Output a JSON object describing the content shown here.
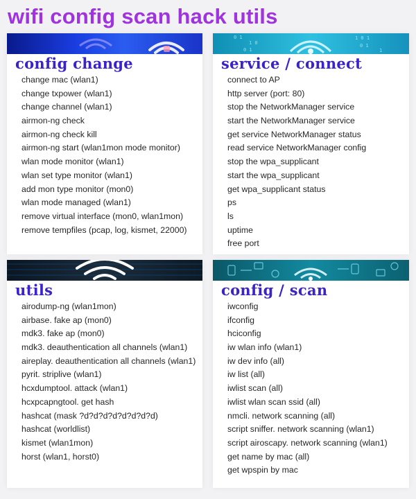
{
  "page": {
    "title": "wifi config scan hack utils"
  },
  "colors": {
    "title": "#9f34de",
    "card_heading": "#3b23c8",
    "item_text": "#262626",
    "background": "#f2f2f4"
  },
  "cards": {
    "config_change": {
      "title": "config change",
      "banner_icon": "wifi-icon",
      "items": [
        "change mac (wlan1)",
        "change txpower (wlan1)",
        "change channel (wlan1)",
        "airmon-ng check",
        "airmon-ng check kill",
        "airmon-ng start (wlan1mon mode monitor)",
        "wlan mode monitor (wlan1)",
        "wlan set type monitor (wlan1)",
        "add mon type monitor (mon0)",
        "wlan mode managed (wlan1)",
        "remove virtual interface (mon0, wlan1mon)",
        "remove tempfiles (pcap, log, kismet, 22000)"
      ]
    },
    "service_connect": {
      "title": "service / connect",
      "banner_icon": "wifi-icon",
      "items": [
        "connect to AP",
        "http server (port: 80)",
        "stop the NetworkManager service",
        "start the NetworkManager service",
        "get service NetworkManager status",
        "read service NetworkManager config",
        "stop the wpa_supplicant",
        "start the wpa_supplicant",
        "get wpa_supplicant status",
        "ps",
        "ls",
        "uptime",
        "free port"
      ]
    },
    "utils": {
      "title": "utils",
      "banner_icon": "wifi-icon",
      "items": [
        "airodump-ng (wlan1mon)",
        "airbase. fake ap (mon0)",
        "mdk3. fake ap (mon0)",
        "mdk3. deauthentication all channels (wlan1)",
        "aireplay. deauthentication all channels (wlan1)",
        "pyrit. striplive (wlan1)",
        "hcxdumptool. attack (wlan1)",
        "hcxpcapngtool. get hash",
        "hashcat (mask ?d?d?d?d?d?d?d?d)",
        "hashcat (worldlist)",
        "kismet (wlan1mon)",
        "horst (wlan1, horst0)"
      ]
    },
    "config_scan": {
      "title": "config / scan",
      "banner_icon": "wifi-icon",
      "items": [
        "iwconfig",
        "ifconfig",
        "hciconfig",
        "iw wlan info (wlan1)",
        "iw dev info (all)",
        "iw list (all)",
        "iwlist scan (all)",
        "iwlist wlan scan ssid (all)",
        "nmcli. network scanning (all)",
        "script sniffer. network scanning (wlan1)",
        "script airoscapy. network scanning (wlan1)",
        "get name by mac (all)",
        "get wpspin by mac"
      ]
    }
  }
}
